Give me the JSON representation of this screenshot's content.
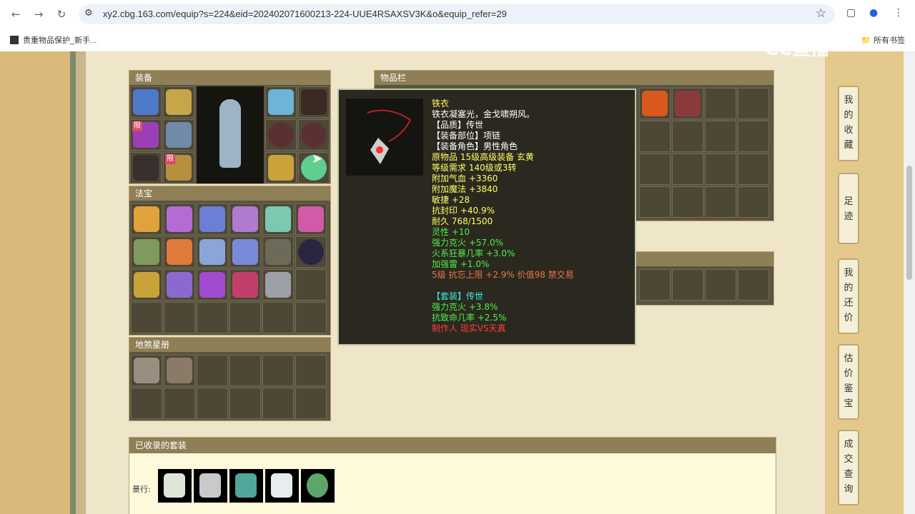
{
  "browser": {
    "url": "xy2.cbg.163.com/equip?s=224&eid=202402071600213-224-UUE4RSAXSV3K&o&equip_refer=29",
    "bookmark": "贵重物品保护_新手...",
    "all_bookmarks": "所有书签"
  },
  "panels": {
    "equip": "装备",
    "fabao": "法宝",
    "disha": "地煞星册",
    "items": "物品栏",
    "limit_tag": "限"
  },
  "tooltip": {
    "name": "铁衣",
    "lines": [
      {
        "text": "铁衣凝塞光，金戈啸朔风。",
        "color": "w"
      },
      {
        "text": "【品质】传世",
        "color": "w"
      },
      {
        "text": "【装备部位】项链",
        "color": "w"
      },
      {
        "text": "【装备角色】男性角色",
        "color": "w"
      },
      {
        "text": "原物品 15级高级装备 玄黄",
        "color": "y"
      },
      {
        "text": "等级需求 140级或3转",
        "color": "y"
      },
      {
        "text": "附加气血 +3360",
        "color": "y"
      },
      {
        "text": "附加魔法 +3840",
        "color": "y"
      },
      {
        "text": "敏捷 +28",
        "color": "y"
      },
      {
        "text": "抗封印 +40.9%",
        "color": "y"
      },
      {
        "text": "耐久 768/1500",
        "color": "y"
      },
      {
        "text": "灵性 +10",
        "color": "g"
      },
      {
        "text": "强力克火 +57.0%",
        "color": "g"
      },
      {
        "text": "火系狂暴几率 +3.0%",
        "color": "g"
      },
      {
        "text": "加强雷 +1.0%",
        "color": "g"
      },
      {
        "text": "5级 抗忘上限 +2.9% 价值98 禁交易",
        "color": "o"
      },
      {
        "text": "",
        "color": "w"
      },
      {
        "text": "【套装】传世",
        "color": "t"
      },
      {
        "text": "强力克火 +3.8%",
        "color": "g"
      },
      {
        "text": "抗致命几率 +2.5%",
        "color": "g"
      },
      {
        "text": "制作人 现实VS天真",
        "color": "r"
      }
    ]
  },
  "set_panel": {
    "title": "已收录的套装",
    "label": "景行:"
  },
  "right_menu": [
    {
      "label": "我的收藏"
    },
    {
      "label": "足迹"
    },
    {
      "label": "我的还价"
    },
    {
      "label": "估价鉴宝"
    },
    {
      "label": "成交查询"
    }
  ],
  "watermark": "CC直播",
  "colors": {
    "panel_title": "#8f7f56",
    "cell": "#4d4836",
    "tooltip_bg": "#2b291f"
  }
}
